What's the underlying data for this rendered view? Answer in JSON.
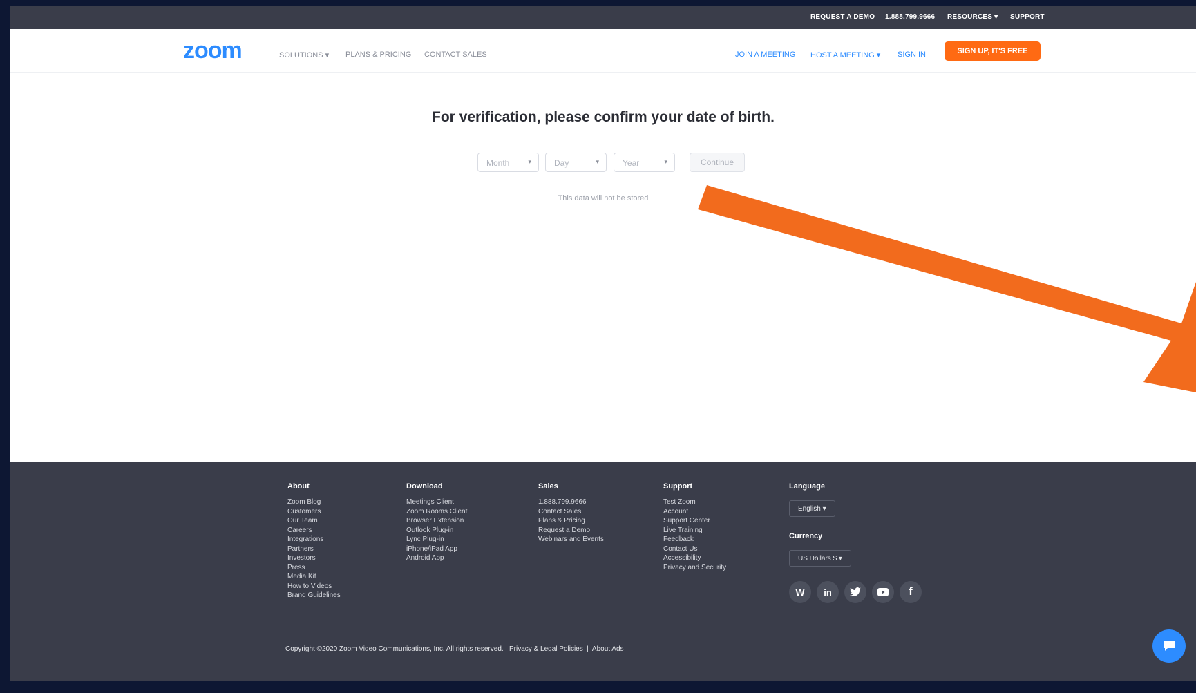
{
  "topbar": {
    "request_demo": "REQUEST A DEMO",
    "phone": "1.888.799.9666",
    "resources": "RESOURCES ▾",
    "support": "SUPPORT"
  },
  "nav": {
    "logo": "zoom",
    "solutions": "SOLUTIONS ▾",
    "plans": "PLANS & PRICING",
    "contact_sales": "CONTACT SALES",
    "join": "JOIN A MEETING",
    "host": "HOST A MEETING ▾",
    "sign_in": "SIGN IN",
    "signup": "SIGN UP, IT'S FREE"
  },
  "verification": {
    "title": "For verification, please confirm your date of birth.",
    "month_placeholder": "Month",
    "day_placeholder": "Day",
    "year_placeholder": "Year",
    "continue": "Continue",
    "note": "This data will not be stored"
  },
  "footer": {
    "columns": [
      {
        "title": "About",
        "items": [
          "Zoom Blog",
          "Customers",
          "Our Team",
          "Careers",
          "Integrations",
          "Partners",
          "Investors",
          "Press",
          "Media Kit",
          "How to Videos",
          "Brand Guidelines"
        ]
      },
      {
        "title": "Download",
        "items": [
          "Meetings Client",
          "Zoom Rooms Client",
          "Browser Extension",
          "Outlook Plug-in",
          "Lync Plug-in",
          "iPhone/iPad App",
          "Android App"
        ]
      },
      {
        "title": "Sales",
        "items": [
          "1.888.799.9666",
          "Contact Sales",
          "Plans & Pricing",
          "Request a Demo",
          "Webinars and Events"
        ]
      },
      {
        "title": "Support",
        "items": [
          "Test Zoom",
          "Account",
          "Support Center",
          "Live Training",
          "Feedback",
          "Contact Us",
          "Accessibility",
          "Privacy and Security"
        ]
      }
    ],
    "language_title": "Language",
    "language_value": "English ▾",
    "currency_title": "Currency",
    "currency_value": "US Dollars $ ▾",
    "copyright": "Copyright ©2020 Zoom Video Communications, Inc. All rights reserved.",
    "privacy": "Privacy & Legal Policies",
    "about_ads": "About Ads",
    "separator": "|"
  },
  "social": [
    "wordpress-icon",
    "linkedin-icon",
    "twitter-icon",
    "youtube-icon",
    "facebook-icon"
  ],
  "colors": {
    "brand_blue": "#2d8cff",
    "accent_orange": "#ff6a13",
    "footer_bg": "#3a3d4a"
  }
}
